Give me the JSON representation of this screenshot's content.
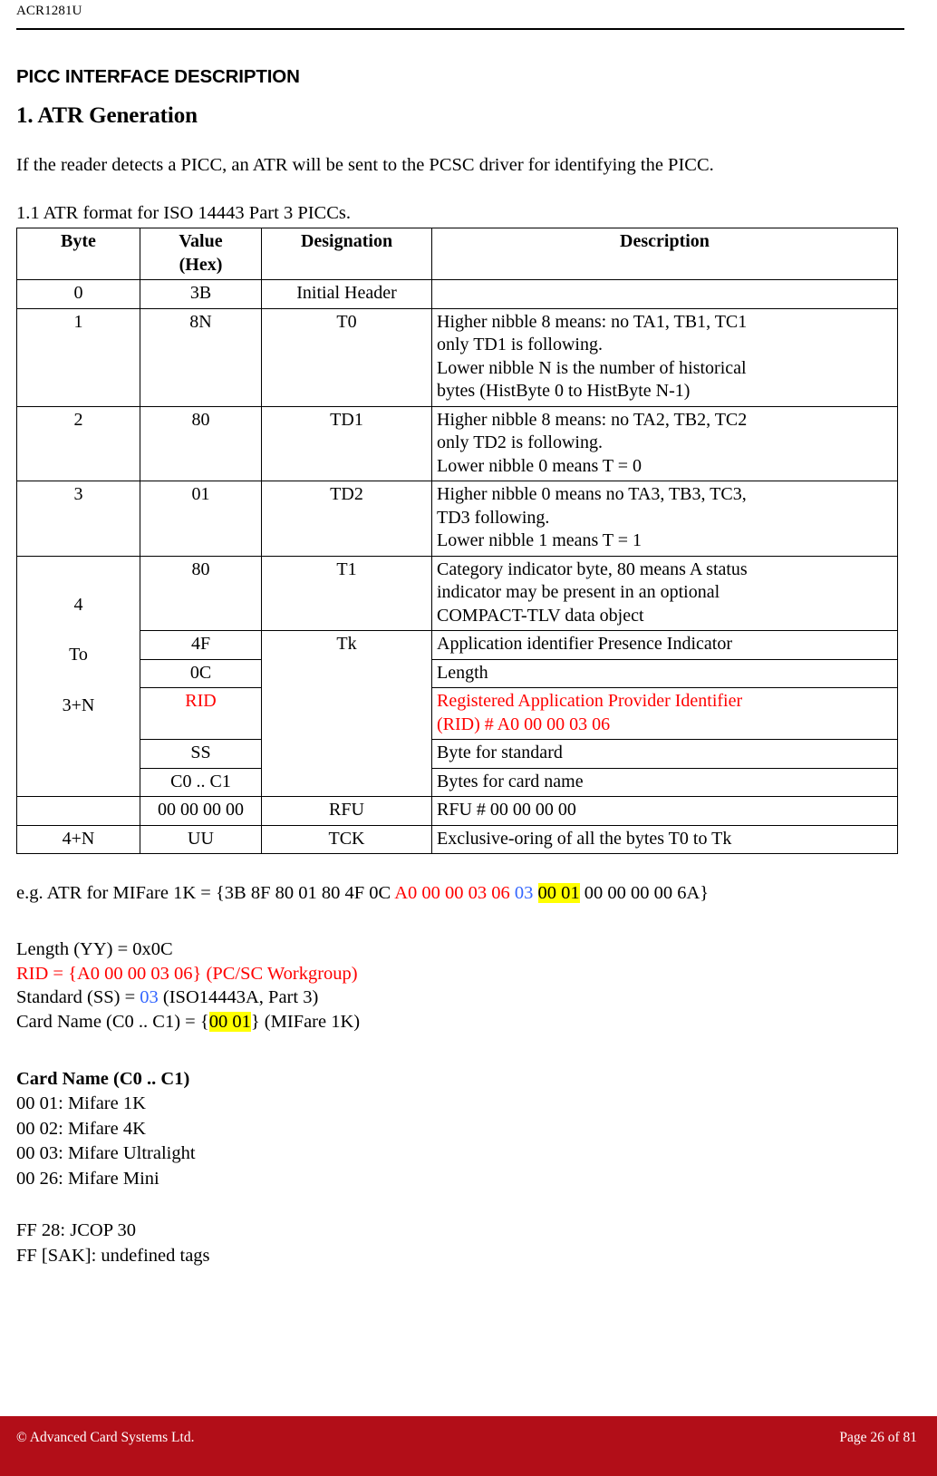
{
  "header": {
    "running_head": "ACR1281U"
  },
  "document": {
    "section_title": "PICC INTERFACE DESCRIPTION",
    "sub_title": "1. ATR Generation",
    "intro_paragraph": "If the reader detects a PICC, an ATR will be sent to the PCSC driver for identifying the PICC.",
    "table_caption": "1.1 ATR format for ISO 14443 Part 3 PICCs."
  },
  "table": {
    "columns": [
      "Byte",
      "Value (Hex)",
      "Designation",
      "Description"
    ],
    "column_header_byte": "Byte",
    "column_header_value_line1": "Value",
    "column_header_value_line2": "(Hex)",
    "column_header_designation": "Designation",
    "column_header_description": "Description",
    "rows": [
      {
        "byte": "0",
        "value": "3B",
        "designation": "Initial Header",
        "description": ""
      },
      {
        "byte": "1",
        "value": "8N",
        "designation": "T0",
        "description": "Higher nibble 8 means: no TA1, TB1, TC1 only TD1 is following.\nLower nibble N is the number of historical bytes (HistByte 0 to HistByte N-1)"
      },
      {
        "byte": "2",
        "value": "80",
        "designation": "TD1",
        "description": "Higher nibble 8 means: no TA2, TB2, TC2 only TD2 is following.\nLower nibble 0 means T = 0"
      },
      {
        "byte": "3",
        "value": "01",
        "designation": "TD2",
        "description": "Higher nibble 0 means no TA3, TB3, TC3, TD3 following.\nLower nibble 1 means T = 1"
      }
    ],
    "span_byte_cell": {
      "line1": "4",
      "line2": "To",
      "line3": "3+N"
    },
    "span_rows": [
      {
        "value": "80",
        "designation": "T1",
        "description": "Category indicator byte, 80 means A status indicator may be present in an optional COMPACT-TLV data object"
      },
      {
        "value": "4F",
        "designation": "Tk",
        "description": "Application identifier Presence Indicator"
      },
      {
        "value": "0C",
        "designation": "",
        "description": "Length"
      },
      {
        "value": "RID",
        "designation": "",
        "description": "Registered Application Provider Identifier (RID) # A0 00 00 03 06"
      },
      {
        "value": "SS",
        "designation": "",
        "description": "Byte for standard"
      },
      {
        "value": "C0 .. C1",
        "designation": "",
        "description": "Bytes for card name"
      }
    ],
    "rfu_row": {
      "byte": "",
      "value": "00 00 00 00",
      "designation": "RFU",
      "description": "RFU # 00 00 00 00"
    },
    "last_row": {
      "byte": "4+N",
      "value": "UU",
      "designation": "TCK",
      "description": "Exclusive-oring of all the bytes T0 to Tk"
    }
  },
  "example": {
    "label": "e.g. ATR for MIFare 1K  = {3B 8F 80 01 80 4F 0C ",
    "rid_bytes": "A0 00 00 03 06",
    "standard_byte": "03",
    "card_name_bytes": "00 01",
    "trailing_bytes": " 00 00 00 00 6A}"
  },
  "definitions": {
    "length_line": "Length (YY) = 0x0C",
    "rid_line_prefix": "RID = {",
    "rid_line_value": "A0 00 00 03 06",
    "rid_line_suffix": "} (PC/SC Workgroup)",
    "standard_prefix": "Standard (SS) = ",
    "standard_value": "03",
    "standard_suffix": " (ISO14443A, Part 3)",
    "cardname_prefix": "Card Name (C0 .. C1) = {",
    "cardname_value": "00 01",
    "cardname_suffix": "} (MIFare 1K)"
  },
  "card_names": {
    "heading": "Card Name (C0 .. C1)",
    "items": [
      "00 01: Mifare 1K",
      "00 02: Mifare 4K",
      "00 03: Mifare Ultralight",
      "00 26: Mifare Mini"
    ],
    "items2": [
      "FF 28: JCOP 30",
      "FF [SAK]: undefined tags"
    ]
  },
  "footer": {
    "copyright": "© Advanced Card Systems Ltd.",
    "page": "Page 26 of 81",
    "bar_color": "#B20E18"
  },
  "colors": {
    "red": "#FF0000",
    "blue": "#3366FF",
    "highlight": "#FFFF00"
  }
}
